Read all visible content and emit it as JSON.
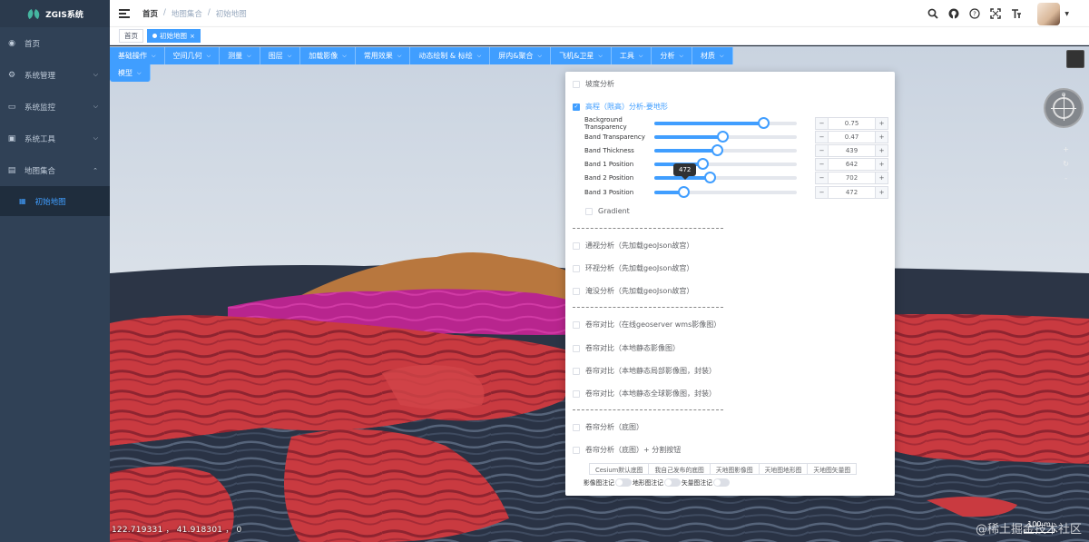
{
  "app": {
    "title": "ZGIS系统"
  },
  "sidebar": {
    "items": [
      {
        "label": "首页",
        "icon": "dashboard-icon"
      },
      {
        "label": "系统管理",
        "icon": "gear-icon"
      },
      {
        "label": "系统监控",
        "icon": "monitor-icon"
      },
      {
        "label": "系统工具",
        "icon": "toolbox-icon"
      },
      {
        "label": "地图集合",
        "icon": "folder-icon"
      }
    ],
    "subitem": {
      "label": "初始地图",
      "icon": "grid-icon"
    }
  },
  "breadcrumb": [
    "首页",
    "/",
    "地图集合",
    "/",
    "初始地图"
  ],
  "tags": [
    {
      "label": "首页"
    },
    {
      "label": "初始地图",
      "close": "×"
    }
  ],
  "toolbar": {
    "row1": [
      "基础操作",
      "空间几何",
      "测量",
      "图层",
      "加载影像",
      "常用效果",
      "动态绘制 & 标绘",
      "屏内&聚合",
      "飞机&卫星",
      "工具",
      "分析",
      "材质"
    ],
    "row2": [
      "模型"
    ],
    "caret": "⌵"
  },
  "panel": {
    "slope": "坡度分析",
    "elevation": "高程（限高）分析-要地形",
    "sliders": [
      {
        "label": "Background Transparency",
        "value": "0.75",
        "frac": 0.77
      },
      {
        "label": "Band Transparency",
        "value": "0.47",
        "frac": 0.48
      },
      {
        "label": "Band Thickness",
        "value": "439",
        "frac": 0.44
      },
      {
        "label": "Band 1 Position",
        "value": "642",
        "frac": 0.34
      },
      {
        "label": "Band 2 Position",
        "value": "702",
        "frac": 0.39
      },
      {
        "label": "Band 3 Position",
        "value": "472",
        "frac": 0.21
      }
    ],
    "tooltip": "472",
    "gradient": "Gradient",
    "group2": [
      "通视分析（先加载geoJson故宫）",
      "环视分析（先加载geoJson故宫）",
      "淹没分析（先加载geoJson故宫）"
    ],
    "group3": [
      "卷帘对比（在线geoserver wms影像图）",
      "卷帘对比（本地静态影像图）",
      "卷帘对比（本地静态局部影像图，封装）",
      "卷帘对比（本地静态全球影像图，封装）"
    ],
    "group4": [
      "卷帘分析（底图）",
      "卷帘分析（底图）+ 分割按钮"
    ],
    "basemaps": [
      "Cesium默认底图",
      "我自己发布的底图",
      "天地图影像图",
      "天地图地形图",
      "天地图矢量图"
    ],
    "switches": [
      "影像图注记",
      "地形图注记",
      "矢量图注记"
    ]
  },
  "status": {
    "coords": "122.719331 ， 41.918301 ， 0",
    "scale": "100 m",
    "watermark": "@稀土掘金技术社区"
  },
  "colors": {
    "accent": "#409eff",
    "sidebar": "#304156",
    "terrain_red": "#c8393f",
    "terrain_magenta": "#b8258e",
    "terrain_tan": "#b8773e"
  }
}
